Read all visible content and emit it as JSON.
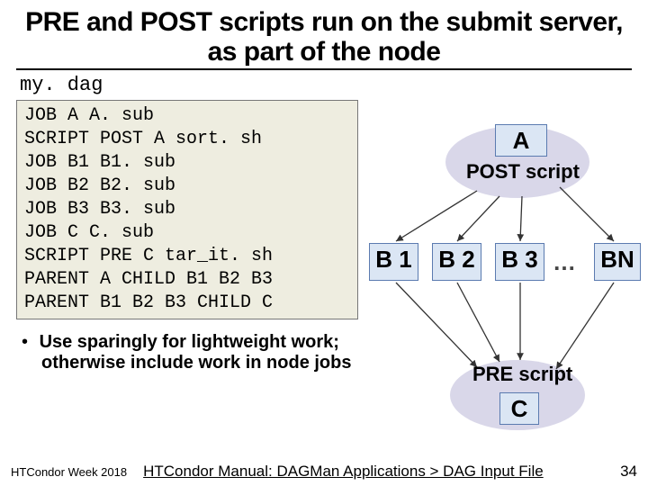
{
  "title": "PRE and POST scripts run on the submit server, as part of the node",
  "filename": "my. dag",
  "code": {
    "l1": "JOB A A. sub",
    "l2": "SCRIPT POST A sort. sh",
    "l3": "JOB B1 B1. sub",
    "l4": "JOB B2 B2. sub",
    "l5": "JOB B3 B3. sub",
    "l6": "JOB C C. sub",
    "l7": "SCRIPT PRE C tar_it. sh",
    "l8": "PARENT A CHILD B1 B2 B3",
    "l9": "PARENT B1 B2 B3 CHILD C"
  },
  "bullet": {
    "line1": "Use sparingly for lightweight work;",
    "line2": "otherwise include work in node jobs"
  },
  "diagram": {
    "A": "A",
    "B1": "B 1",
    "B2": "B 2",
    "B3": "B 3",
    "BN": "BN",
    "C": "C",
    "dots": "…",
    "post": "POST script",
    "pre": "PRE script"
  },
  "footer": {
    "left": "HTCondor Week 2018",
    "mid": "HTCondor Manual: DAGMan Applications > DAG Input File",
    "page": "34"
  }
}
